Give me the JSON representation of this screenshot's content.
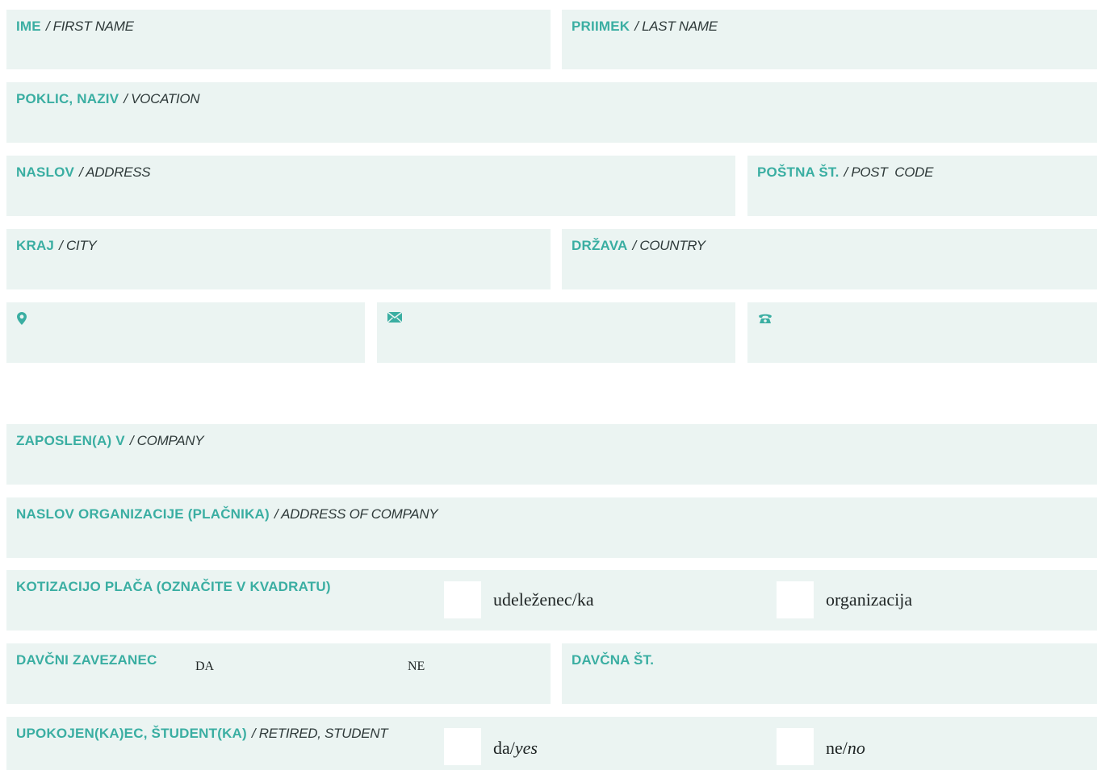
{
  "personal": {
    "first_name": {
      "bold": "IME",
      "italic": "/ FIRST NAME"
    },
    "last_name": {
      "bold": "PRIIMEK",
      "italic": "/ LAST NAME"
    },
    "vocation": {
      "bold": "POKLIC, NAZIV",
      "italic": "/ VOCATION"
    },
    "address": {
      "bold": "NASLOV",
      "italic": "/ ADDRESS"
    },
    "post_code": {
      "bold": "POŠTNA ŠT.",
      "italic": "/ POST  CODE"
    },
    "city": {
      "bold": "KRAJ",
      "italic": "/ CITY"
    },
    "country": {
      "bold": "DRŽAVA",
      "italic": "/ COUNTRY"
    }
  },
  "contact_icons": {
    "location": "location-pin-icon",
    "email": "envelope-icon",
    "phone": "telephone-icon"
  },
  "company": {
    "company": {
      "bold": "ZAPOSLEN(A) V",
      "italic": "/ COMPANY"
    },
    "company_address": {
      "bold": "NASLOV ORGANIZACIJE (PLAČNIKA)",
      "italic": "/ ADDRESS OF COMPANY"
    }
  },
  "fee": {
    "label": "KOTIZACIJO PLAČA (OZNAČITE V KVADRATU)",
    "option1": "udeleženec/ka",
    "option2": "organizacija"
  },
  "tax": {
    "label": "DAVČNI ZAVEZANEC",
    "yes": "DA",
    "no": "NE",
    "number_label": "DAVČNA ŠT."
  },
  "retired": {
    "bold": "UPOKOJEN(KA)EC, ŠTUDENT(KA)",
    "italic": "/ RETIRED, STUDENT",
    "yes_sl": "da/",
    "yes_en": "yes",
    "no_sl": "ne/",
    "no_en": "no"
  },
  "colors": {
    "accent": "#3aaea2",
    "field_bg": "#ebf4f2",
    "text": "#1e2424"
  }
}
